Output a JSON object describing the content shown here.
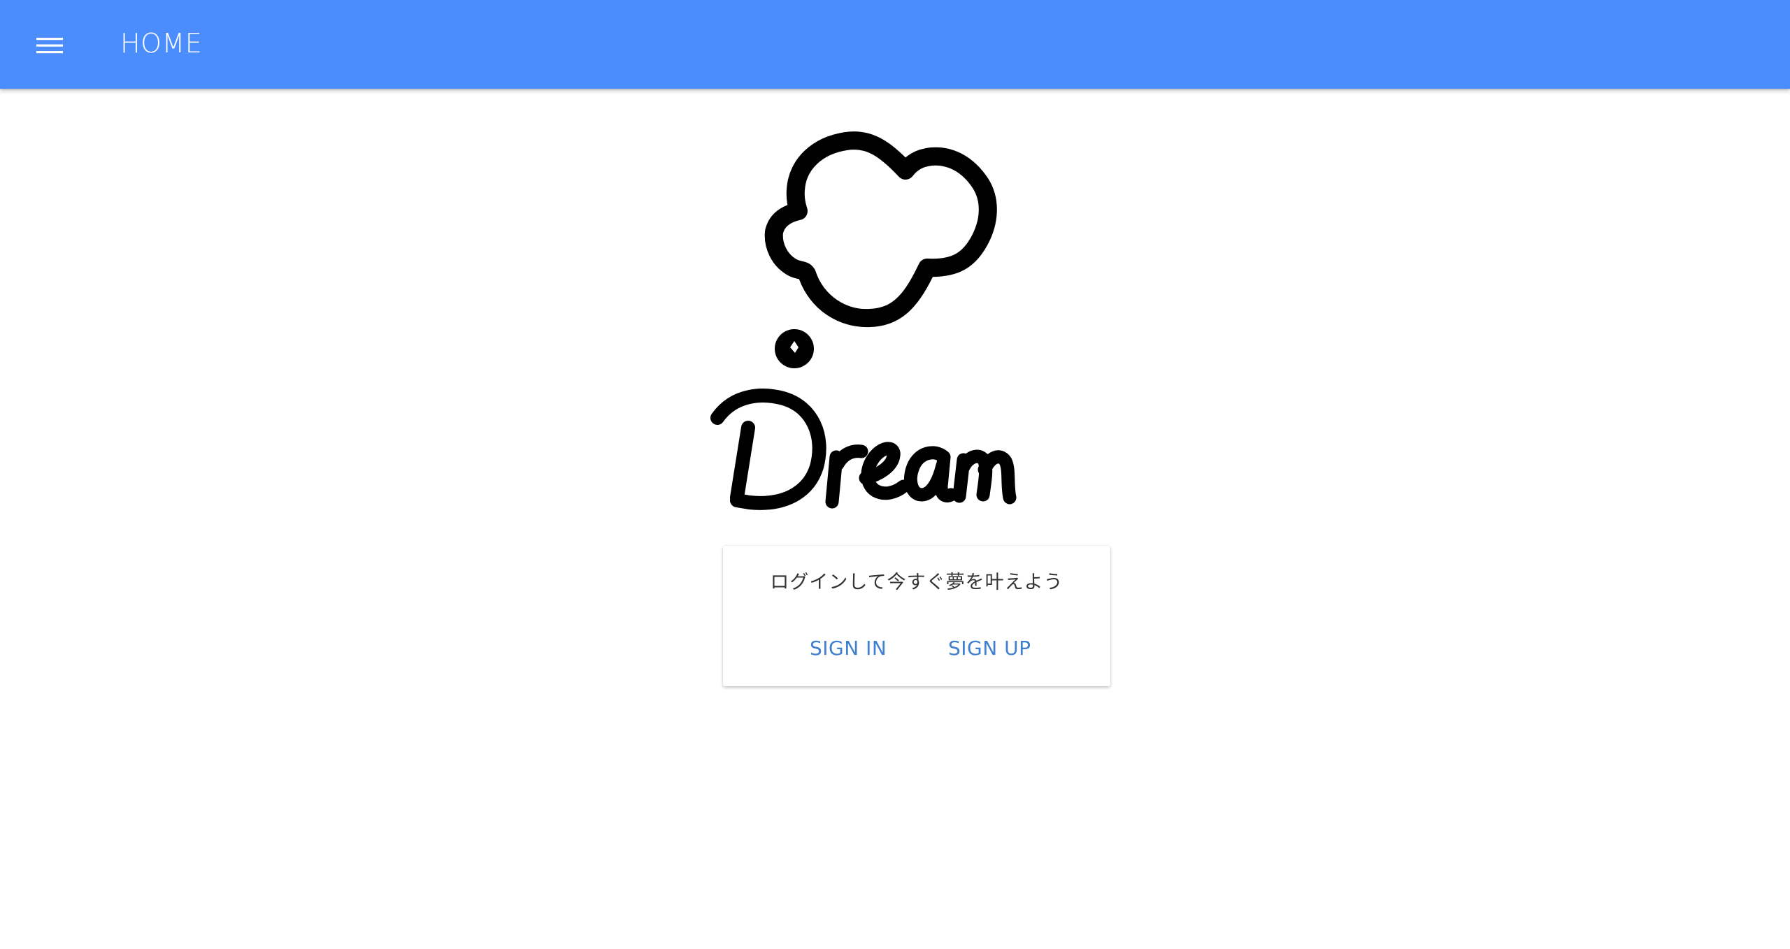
{
  "app_bar": {
    "menu_icon": "menu-icon",
    "title": "HOME",
    "color": "#4c8dfd"
  },
  "logo": {
    "icon": "thought-bubble-icon",
    "wordmark": "Dream"
  },
  "card": {
    "message": "ログインして今すぐ夢を叶えよう",
    "sign_in_label": "SIGN IN",
    "sign_up_label": "SIGN UP",
    "button_color": "#3f7fd0"
  }
}
